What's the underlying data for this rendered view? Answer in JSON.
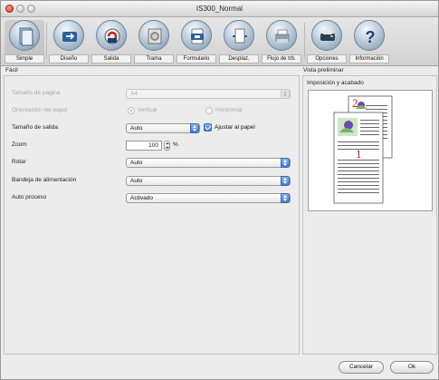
{
  "window": {
    "title": "IS300_Normal"
  },
  "toolbar": {
    "tabs": [
      {
        "label": "Simple",
        "icon": "simple-page-icon"
      },
      {
        "label": "Diseño",
        "icon": "layout-icon"
      },
      {
        "label": "Salida",
        "icon": "output-icon"
      },
      {
        "label": "Trama",
        "icon": "screen-pattern-icon"
      },
      {
        "label": "Formulario",
        "icon": "form-icon"
      },
      {
        "label": "Desplaz.",
        "icon": "shift-icon"
      },
      {
        "label": "Flujo de trb.",
        "icon": "workflow-icon"
      },
      {
        "label": "Opciones",
        "icon": "printer-options-icon"
      },
      {
        "label": "Información",
        "icon": "help-icon"
      }
    ]
  },
  "left_panel": {
    "heading": "Fácil",
    "fields": {
      "page_size": {
        "label": "Tamaño de página",
        "value": "A4",
        "disabled": true
      },
      "orientation": {
        "label": "Orientación del papel",
        "vertical": "Vertical",
        "horizontal": "Horizontal",
        "selected": "Vertical",
        "disabled": true
      },
      "output_size": {
        "label": "Tamaño de salida",
        "value": "Auto",
        "fit_label": "Ajustar al papel",
        "fit_checked": true
      },
      "zoom": {
        "label": "Zoom",
        "value": "100",
        "unit": "%"
      },
      "rotate": {
        "label": "Rotar",
        "value": "Auto"
      },
      "tray": {
        "label": "Bandeja de alimentación",
        "value": "Auto"
      },
      "auto_process": {
        "label": "Auto proceso",
        "value": "Activado"
      }
    }
  },
  "right_panel": {
    "heading": "Vista preliminar",
    "title": "Imposición y acabado",
    "preview": {
      "page_back": "2",
      "page_front": "1"
    }
  },
  "buttons": {
    "cancel": "Cancelar",
    "ok": "Ok"
  }
}
